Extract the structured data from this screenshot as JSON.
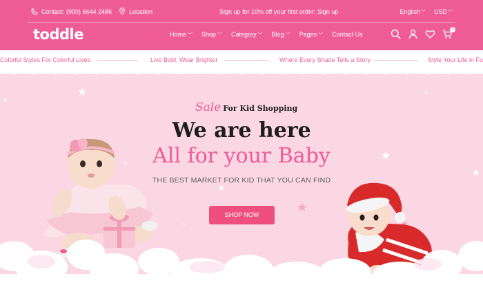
{
  "topbar": {
    "phone": "Contact: (900) 6644 2486",
    "location": "Location",
    "promo": "Sign up for 10% off your first order: Sign up",
    "language": "English",
    "currency": "USD"
  },
  "brand": {
    "logo_text": "toddle"
  },
  "nav": {
    "items": [
      {
        "label": "Home"
      },
      {
        "label": "Shop"
      },
      {
        "label": "Category"
      },
      {
        "label": "Blog"
      },
      {
        "label": "Pages"
      },
      {
        "label": "Contact Us"
      }
    ],
    "cart_count": "0"
  },
  "marquee": {
    "items": [
      "Colorful Styles For Colorful Lives",
      "Live Bold, Wear Brighter",
      "Where Every Shade Tells a Story",
      "Style Your Life in Full"
    ]
  },
  "hero": {
    "sale_word": "Sale",
    "sale_rest": "For Kid Shopping",
    "title_line1": "We are here",
    "title_line2": "All for your Baby",
    "subtitle": "THE BEST MARKET FOR KID THAT YOU CAN FIND",
    "cta": "SHOP NOW"
  },
  "colors": {
    "brand": "#ef5c95",
    "hero_bg": "#fbd6e3",
    "cta": "#ef4f7f"
  }
}
